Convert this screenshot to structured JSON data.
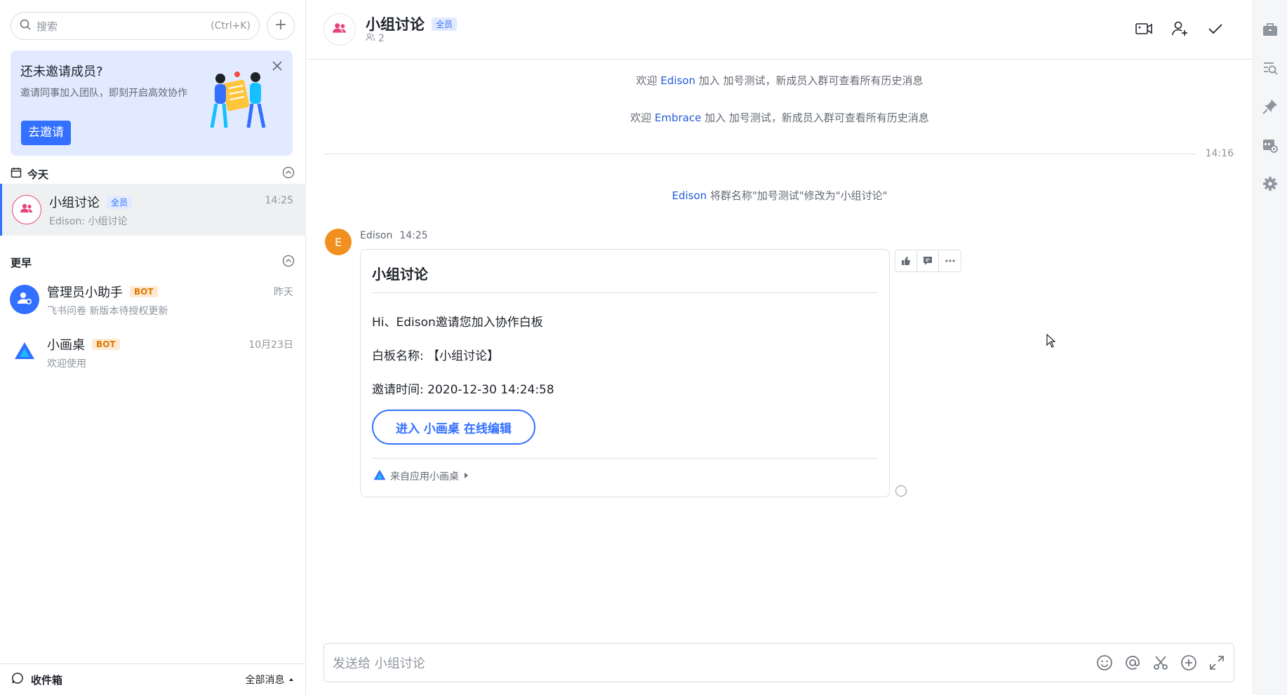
{
  "search": {
    "placeholder": "搜索",
    "shortcut": "(Ctrl+K)"
  },
  "invite_card": {
    "title": "还未邀请成员?",
    "description": "邀请同事加入团队，即刻开启高效协作",
    "button": "去邀请"
  },
  "sections": {
    "today": "今天",
    "earlier": "更早"
  },
  "conversations": [
    {
      "name": "小组讨论",
      "tag": "全员",
      "preview": "Edison: 小组讨论",
      "time": "14:25",
      "active": true
    },
    {
      "name": "管理员小助手",
      "tag": "BOT",
      "preview": "飞书问卷 新版本待授权更新",
      "time": "昨天"
    },
    {
      "name": "小画桌",
      "tag": "BOT",
      "preview": "欢迎使用",
      "time": "10月23日"
    }
  ],
  "footer": {
    "inbox": "收件箱",
    "filter": "全部消息"
  },
  "chat": {
    "title": "小组讨论",
    "tag": "全员",
    "member_count": "2",
    "system_messages": [
      {
        "prefix": "欢迎 ",
        "who": "Edison",
        "suffix": " 加入 加号测试，新成员入群可查看所有历史消息"
      },
      {
        "prefix": "欢迎 ",
        "who": "Embrace",
        "suffix": " 加入 加号测试，新成员入群可查看所有历史消息"
      }
    ],
    "divider_time": "14:16",
    "rename_msg": {
      "who": "Edison",
      "text": " 将群名称\"加号测试\"修改为\"小组讨论\""
    },
    "message": {
      "avatar_letter": "E",
      "sender": "Edison",
      "time": "14:25",
      "card": {
        "title": "小组讨论",
        "line1": "Hi、Edison邀请您加入协作白板",
        "line2": "白板名称: 【小组讨论】",
        "line3": "邀请时间: 2020-12-30 14:24:58",
        "button": "进入 小画桌 在线编辑",
        "source": "来自应用小画桌"
      }
    },
    "composer_placeholder": "发送给 小组讨论"
  },
  "colors": {
    "accent": "#3370ff",
    "group_avatar": "#e8457b",
    "sender_avatar": "#f1901e",
    "bot_tag": "#de7802"
  }
}
